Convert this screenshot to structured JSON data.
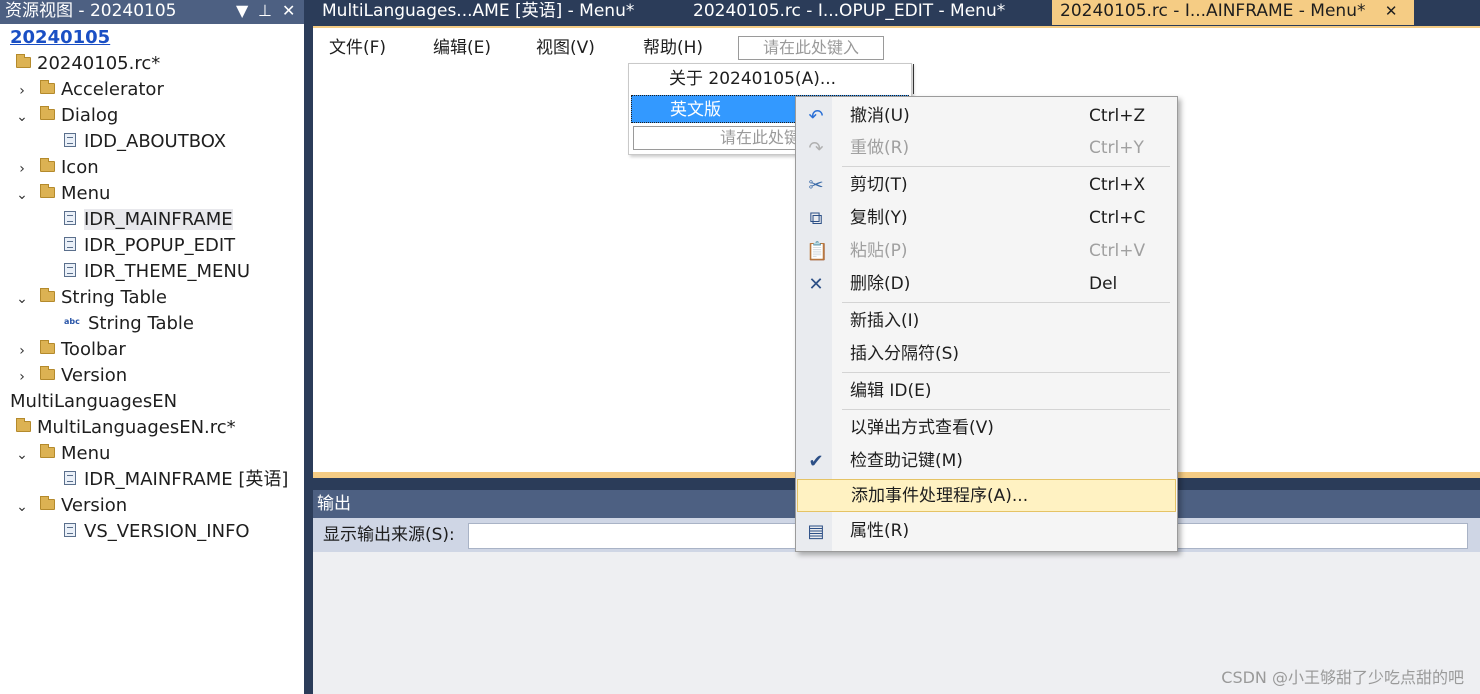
{
  "resource_view": {
    "title": "资源视图 - 20240105",
    "controls": {
      "dropdown": "▼",
      "pin": "⊥",
      "close": "✕"
    },
    "tree": [
      {
        "label": "20240105",
        "indent": 0,
        "kind": "root",
        "toggle": ""
      },
      {
        "label": "20240105.rc*",
        "indent": 1,
        "kind": "folder",
        "toggle": ""
      },
      {
        "label": "Accelerator",
        "indent": 2,
        "kind": "folder",
        "toggle": "›"
      },
      {
        "label": "Dialog",
        "indent": 2,
        "kind": "folder",
        "toggle": "⌄"
      },
      {
        "label": "IDD_ABOUTBOX",
        "indent": 3,
        "kind": "res",
        "toggle": ""
      },
      {
        "label": "Icon",
        "indent": 2,
        "kind": "folder",
        "toggle": "›"
      },
      {
        "label": "Menu",
        "indent": 2,
        "kind": "folder",
        "toggle": "⌄"
      },
      {
        "label": "IDR_MAINFRAME",
        "indent": 3,
        "kind": "res",
        "toggle": "",
        "selected": true
      },
      {
        "label": "IDR_POPUP_EDIT",
        "indent": 3,
        "kind": "res",
        "toggle": ""
      },
      {
        "label": "IDR_THEME_MENU",
        "indent": 3,
        "kind": "res",
        "toggle": ""
      },
      {
        "label": "String Table",
        "indent": 2,
        "kind": "folder",
        "toggle": "⌄"
      },
      {
        "label": "String Table",
        "indent": 3,
        "kind": "abc",
        "toggle": ""
      },
      {
        "label": "Toolbar",
        "indent": 2,
        "kind": "folder",
        "toggle": "›"
      },
      {
        "label": "Version",
        "indent": 2,
        "kind": "folder",
        "toggle": "›"
      },
      {
        "label": "MultiLanguagesEN",
        "indent": 0,
        "kind": "plain",
        "toggle": ""
      },
      {
        "label": "MultiLanguagesEN.rc*",
        "indent": 1,
        "kind": "folder",
        "toggle": ""
      },
      {
        "label": "Menu",
        "indent": 2,
        "kind": "folder",
        "toggle": "⌄"
      },
      {
        "label": "IDR_MAINFRAME [英语]",
        "indent": 3,
        "kind": "res",
        "toggle": ""
      },
      {
        "label": "Version",
        "indent": 2,
        "kind": "folder",
        "toggle": "⌄"
      },
      {
        "label": "VS_VERSION_INFO",
        "indent": 3,
        "kind": "res",
        "toggle": ""
      }
    ]
  },
  "tabs": [
    {
      "label": "MultiLanguages...AME [英语] - Menu*",
      "active": false
    },
    {
      "label": "20240105.rc - I...OPUP_EDIT - Menu*",
      "active": false
    },
    {
      "label": "20240105.rc - I...AINFRAME - Menu*",
      "active": true,
      "close": "✕"
    }
  ],
  "menubar": {
    "items": [
      "文件(F)",
      "编辑(E)",
      "视图(V)",
      "帮助(H)"
    ],
    "placeholder": "请在此处键入"
  },
  "dropdown": {
    "items": [
      {
        "label": "关于 20240105(A)...",
        "selected": false
      },
      {
        "label": "英文版",
        "selected": true
      }
    ],
    "placeholder": "请在此处键入"
  },
  "context_menu": {
    "items": [
      {
        "icon": "undo-icon",
        "glyph": "↶",
        "label": "撤消(U)",
        "shortcut": "Ctrl+Z",
        "disabled": false
      },
      {
        "icon": "redo-icon",
        "glyph": "↷",
        "label": "重做(R)",
        "shortcut": "Ctrl+Y",
        "disabled": true
      },
      {
        "icon": "cut-icon",
        "glyph": "✂",
        "label": "剪切(T)",
        "shortcut": "Ctrl+X",
        "disabled": false
      },
      {
        "icon": "copy-icon",
        "glyph": "⧉",
        "label": "复制(Y)",
        "shortcut": "Ctrl+C",
        "disabled": false
      },
      {
        "icon": "paste-icon",
        "glyph": "📋",
        "label": "粘贴(P)",
        "shortcut": "Ctrl+V",
        "disabled": true
      },
      {
        "icon": "delete-icon",
        "glyph": "✕",
        "label": "删除(D)",
        "shortcut": "Del",
        "disabled": false
      },
      {
        "icon": "",
        "glyph": "",
        "label": "新插入(I)",
        "shortcut": "",
        "disabled": false
      },
      {
        "icon": "",
        "glyph": "",
        "label": "插入分隔符(S)",
        "shortcut": "",
        "disabled": false
      },
      {
        "icon": "",
        "glyph": "",
        "label": "编辑 ID(E)",
        "shortcut": "",
        "disabled": false
      },
      {
        "icon": "",
        "glyph": "",
        "label": "以弹出方式查看(V)",
        "shortcut": "",
        "disabled": false
      },
      {
        "icon": "check-mnemonics-icon",
        "glyph": "✔",
        "label": "检查助记键(M)",
        "shortcut": "",
        "disabled": false
      },
      {
        "icon": "",
        "glyph": "",
        "label": "添加事件处理程序(A)...",
        "shortcut": "",
        "disabled": false,
        "highlighted": true
      },
      {
        "icon": "properties-icon",
        "glyph": "▤",
        "label": "属性(R)",
        "shortcut": "",
        "disabled": false
      }
    ]
  },
  "output": {
    "title": "输出",
    "source_label": "显示输出来源(S):",
    "source_value": ""
  },
  "watermark": "CSDN @小王够甜了少吃点甜的吧",
  "colors": {
    "chrome": "#2b3c59",
    "panel_title": "#4d6082",
    "active_tab": "#f5cc84",
    "selection": "#3399ff",
    "hover": "#fff2c2"
  }
}
